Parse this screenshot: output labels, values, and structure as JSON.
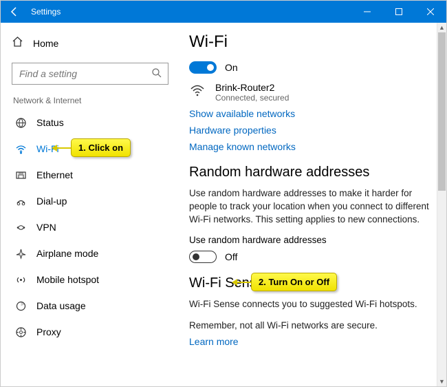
{
  "titlebar": {
    "title": "Settings"
  },
  "sidebar": {
    "home_label": "Home",
    "search_placeholder": "Find a setting",
    "group_label": "Network & Internet",
    "items": [
      {
        "label": "Status"
      },
      {
        "label": "Wi-Fi"
      },
      {
        "label": "Ethernet"
      },
      {
        "label": "Dial-up"
      },
      {
        "label": "VPN"
      },
      {
        "label": "Airplane mode"
      },
      {
        "label": "Mobile hotspot"
      },
      {
        "label": "Data usage"
      },
      {
        "label": "Proxy"
      }
    ]
  },
  "main": {
    "wifi": {
      "heading": "Wi-Fi",
      "toggle_state": "On",
      "network_name": "Brink-Router2",
      "network_status": "Connected, secured",
      "link_available": "Show available networks",
      "link_hardware": "Hardware properties",
      "link_known": "Manage known networks"
    },
    "random": {
      "heading": "Random hardware addresses",
      "body": "Use random hardware addresses to make it harder for people to track your location when you connect to different Wi-Fi networks. This setting applies to new connections.",
      "sub_label": "Use random hardware addresses",
      "toggle_state": "Off"
    },
    "sense": {
      "heading": "Wi-Fi Sense",
      "body1": "Wi-Fi Sense connects you to suggested Wi-Fi hotspots.",
      "body2": "Remember, not all Wi-Fi networks are secure.",
      "link": "Learn more"
    }
  },
  "callouts": {
    "one": "1. Click on",
    "two": "2. Turn On or Off"
  }
}
